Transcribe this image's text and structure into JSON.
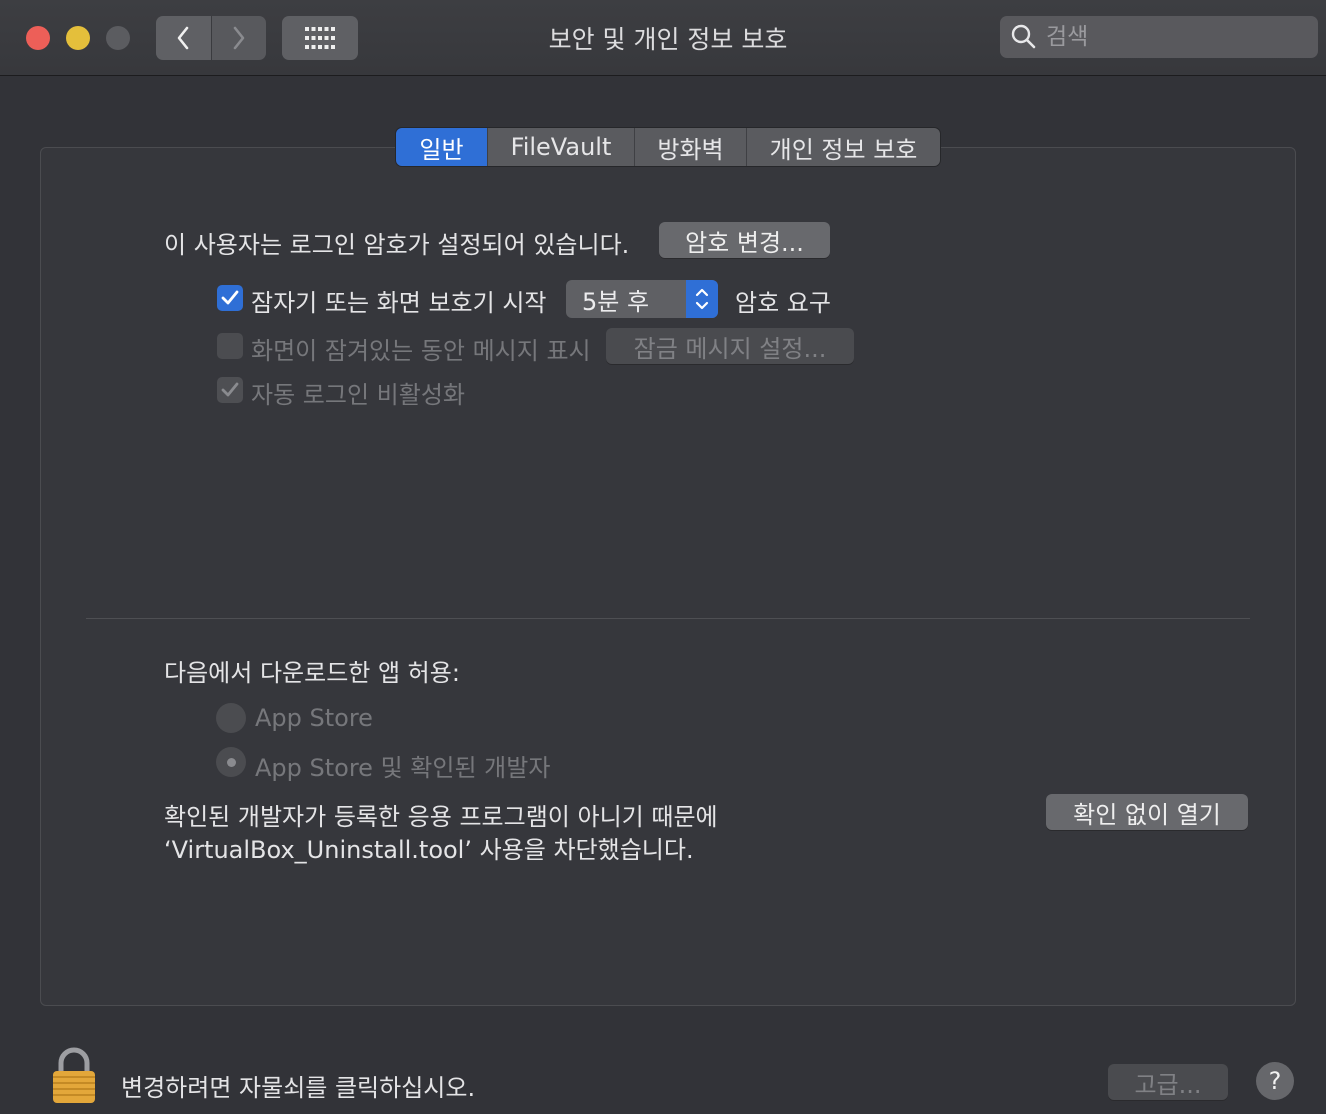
{
  "window": {
    "title": "보안 및 개인 정보 보호",
    "search_placeholder": "검색"
  },
  "tabs": [
    {
      "label": "일반",
      "active": true
    },
    {
      "label": "FileVault",
      "active": false
    },
    {
      "label": "방화벽",
      "active": false
    },
    {
      "label": "개인 정보 보호",
      "active": false
    }
  ],
  "general": {
    "password_set_text": "이 사용자는 로그인 암호가 설정되어 있습니다.",
    "change_password_button": "암호 변경...",
    "require_password_label": "잠자기 또는 화면 보호기 시작",
    "require_password_delay": "5분 후",
    "require_password_suffix": "암호 요구",
    "show_message_label": "화면이 잠겨있는 동안 메시지 표시",
    "set_lock_message_button": "잠금 메시지 설정...",
    "disable_autologin_label": "자동 로그인 비활성화"
  },
  "downloads": {
    "heading": "다음에서 다운로드한 앱 허용:",
    "options": [
      "App Store",
      "App Store 및 확인된 개발자"
    ],
    "selected_option": "App Store 및 확인된 개발자",
    "blocked_line1": "확인된 개발자가 등록한 응용 프로그램이 아니기 때문에",
    "blocked_line2": "‘VirtualBox_Uninstall.tool’ 사용을 차단했습니다.",
    "open_anyway_button": "확인 없이 열기"
  },
  "footer": {
    "lock_text": "변경하려면 자물쇠를 클릭하십시오.",
    "advanced_button": "고급...",
    "help_button": "?"
  },
  "colors": {
    "accent": "#2f6fd6",
    "close": "#ed5f58",
    "minimize": "#e4bf3b"
  }
}
